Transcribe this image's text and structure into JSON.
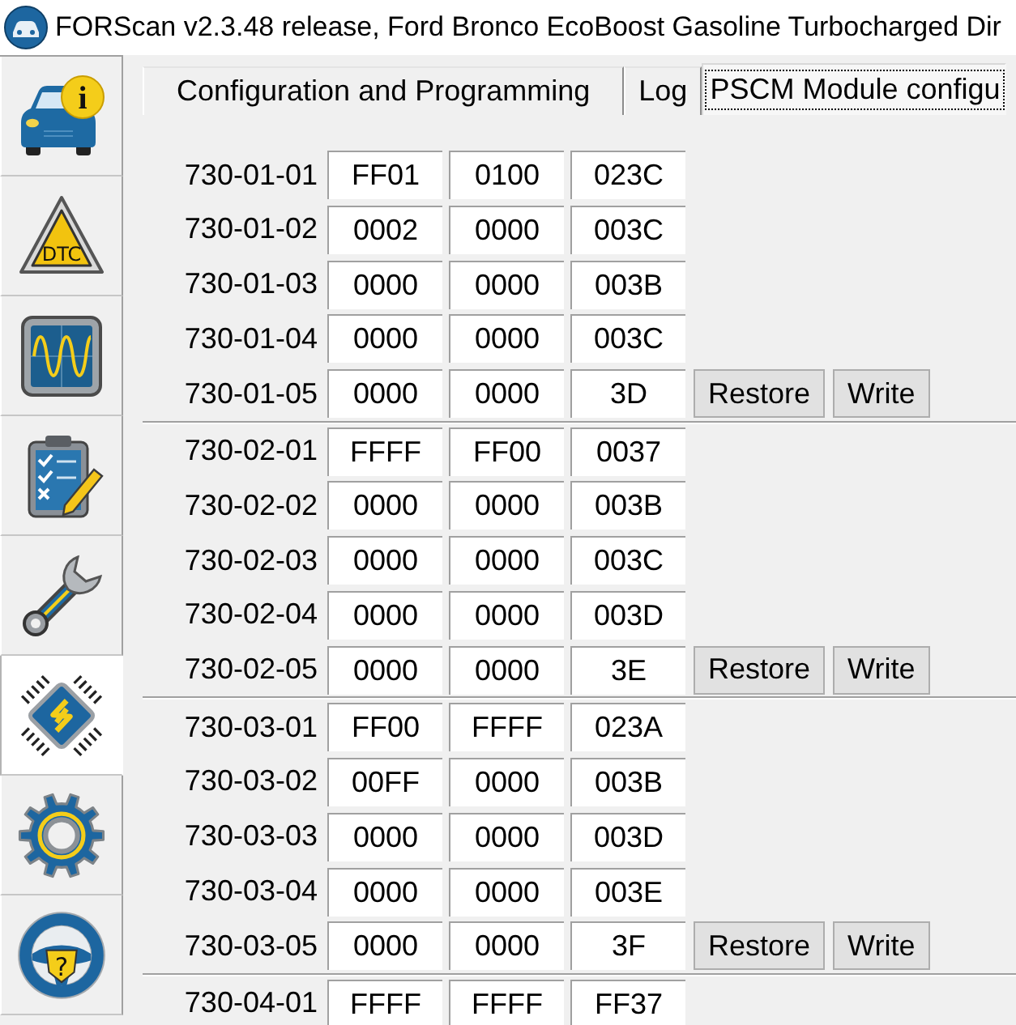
{
  "window": {
    "title": "FORScan v2.3.48 release, Ford Bronco EcoBoost Gasoline Turbocharged Dir"
  },
  "sidebar": {
    "items": [
      {
        "kind": "vehicle-info",
        "badge": "i",
        "selected": false
      },
      {
        "kind": "dtc",
        "badge": "DTC",
        "selected": false
      },
      {
        "kind": "oscilloscope",
        "selected": false
      },
      {
        "kind": "checklist",
        "selected": false
      },
      {
        "kind": "service",
        "selected": false
      },
      {
        "kind": "module",
        "selected": true
      },
      {
        "kind": "settings",
        "selected": false
      },
      {
        "kind": "help",
        "badge": "?",
        "selected": false
      }
    ]
  },
  "tabs": [
    {
      "label": "Configuration and Programming",
      "selected": false
    },
    {
      "label": "Log",
      "selected": false
    },
    {
      "label": "PSCM Module configu",
      "selected": true
    }
  ],
  "groups": [
    {
      "rows": [
        {
          "address": "730-01-01",
          "values": [
            "FF01",
            "0100",
            "023C"
          ]
        },
        {
          "address": "730-01-02",
          "values": [
            "0002",
            "0000",
            "003C"
          ]
        },
        {
          "address": "730-01-03",
          "values": [
            "0000",
            "0000",
            "003B"
          ]
        },
        {
          "address": "730-01-04",
          "values": [
            "0000",
            "0000",
            "003C"
          ]
        },
        {
          "address": "730-01-05",
          "values": [
            "0000",
            "0000",
            "3D"
          ],
          "buttons": [
            "Restore",
            "Write"
          ]
        }
      ]
    },
    {
      "rows": [
        {
          "address": "730-02-01",
          "values": [
            "FFFF",
            "FF00",
            "0037"
          ]
        },
        {
          "address": "730-02-02",
          "values": [
            "0000",
            "0000",
            "003B"
          ]
        },
        {
          "address": "730-02-03",
          "values": [
            "0000",
            "0000",
            "003C"
          ]
        },
        {
          "address": "730-02-04",
          "values": [
            "0000",
            "0000",
            "003D"
          ]
        },
        {
          "address": "730-02-05",
          "values": [
            "0000",
            "0000",
            "3E"
          ],
          "buttons": [
            "Restore",
            "Write"
          ]
        }
      ]
    },
    {
      "rows": [
        {
          "address": "730-03-01",
          "values": [
            "FF00",
            "FFFF",
            "023A"
          ]
        },
        {
          "address": "730-03-02",
          "values": [
            "00FF",
            "0000",
            "003B"
          ]
        },
        {
          "address": "730-03-03",
          "values": [
            "0000",
            "0000",
            "003D"
          ]
        },
        {
          "address": "730-03-04",
          "values": [
            "0000",
            "0000",
            "003E"
          ]
        },
        {
          "address": "730-03-05",
          "values": [
            "0000",
            "0000",
            "3F"
          ],
          "buttons": [
            "Restore",
            "Write"
          ]
        }
      ]
    },
    {
      "rows": [
        {
          "address": "730-04-01",
          "values": [
            "FFFF",
            "FFFF",
            "FF37"
          ]
        }
      ]
    }
  ]
}
